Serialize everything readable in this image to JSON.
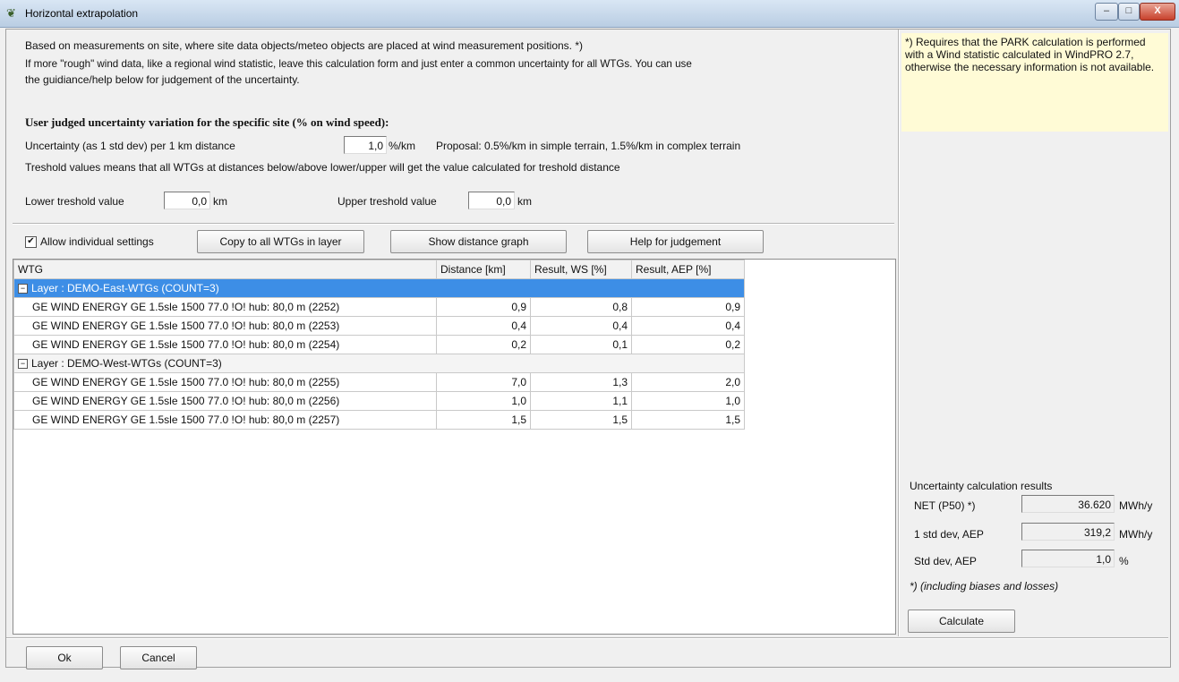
{
  "window": {
    "title": "Horizontal extrapolation",
    "minimize": "–",
    "maximize": "□",
    "close": "X"
  },
  "intro": {
    "line1": "Based on measurements on site, where site data objects/meteo objects are placed at wind measurement positions. *)",
    "line2": "If more \"rough\" wind data, like a regional wind statistic, leave this calculation form and just enter a common uncertainty for all WTGs. You can use",
    "line3": "the guidiance/help below for judgement of the uncertainty."
  },
  "uncertainty": {
    "heading": "User judged uncertainty variation for the specific site (% on wind speed):",
    "per_km_label": "Uncertainty (as 1 std dev) per 1 km distance",
    "per_km_value": "1,0",
    "per_km_unit": "%/km",
    "proposal": "Proposal: 0.5%/km in  simple terrain, 1.5%/km in complex terrain",
    "threshold_note": "Treshold values means that all WTGs at distances below/above lower/upper will get the value calculated for treshold distance",
    "lower_label": "Lower treshold value",
    "lower_value": "0,0",
    "lower_unit": "km",
    "upper_label": "Upper treshold value",
    "upper_value": "0,0",
    "upper_unit": "km"
  },
  "toolbar": {
    "allow_label": "Allow individual settings",
    "allow_checked": "✔",
    "copy_label": "Copy to all WTGs in layer",
    "graph_label": "Show distance graph",
    "help_label": "Help for judgement"
  },
  "table": {
    "columns": [
      "WTG",
      "Distance [km]",
      "Result, WS [%]",
      "Result, AEP [%]"
    ],
    "layers": [
      {
        "label": "Layer : DEMO-East-WTGs (COUNT=3)",
        "expander": "−",
        "rows": [
          {
            "wtg": "GE WIND ENERGY GE 1.5sle 1500 77.0 !O! hub: 80,0 m (2252)",
            "distance": "0,9",
            "ws": "0,8",
            "aep": "0,9"
          },
          {
            "wtg": "GE WIND ENERGY GE 1.5sle 1500 77.0 !O! hub: 80,0 m (2253)",
            "distance": "0,4",
            "ws": "0,4",
            "aep": "0,4"
          },
          {
            "wtg": "GE WIND ENERGY GE 1.5sle 1500 77.0 !O! hub: 80,0 m (2254)",
            "distance": "0,2",
            "ws": "0,1",
            "aep": "0,2"
          }
        ]
      },
      {
        "label": "Layer : DEMO-West-WTGs (COUNT=3)",
        "expander": "−",
        "rows": [
          {
            "wtg": "GE WIND ENERGY GE 1.5sle 1500 77.0 !O! hub: 80,0 m (2255)",
            "distance": "7,0",
            "ws": "1,3",
            "aep": "2,0"
          },
          {
            "wtg": "GE WIND ENERGY GE 1.5sle 1500 77.0 !O! hub: 80,0 m (2256)",
            "distance": "1,0",
            "ws": "1,1",
            "aep": "1,0"
          },
          {
            "wtg": "GE WIND ENERGY GE 1.5sle 1500 77.0 !O! hub: 80,0 m (2257)",
            "distance": "1,5",
            "ws": "1,5",
            "aep": "1,5"
          }
        ]
      }
    ]
  },
  "note": {
    "text": "*) Requires that the PARK calculation is performed with a Wind statistic calculated in WindPRO 2.7, otherwise the necessary information is not available."
  },
  "results": {
    "title": "Uncertainty calculation results",
    "net_label": "NET (P50) *)",
    "net_value": "36.620",
    "net_unit": "MWh/y",
    "std_aep_label": "1 std dev, AEP",
    "std_aep_value": "319,2",
    "std_aep_unit": "MWh/y",
    "std_pct_label": "Std dev, AEP",
    "std_pct_value": "1,0",
    "std_pct_unit": "%",
    "footnote": "*) (including biases and losses)",
    "calculate_label": "Calculate"
  },
  "footer": {
    "ok_label": "Ok",
    "cancel_label": "Cancel"
  }
}
